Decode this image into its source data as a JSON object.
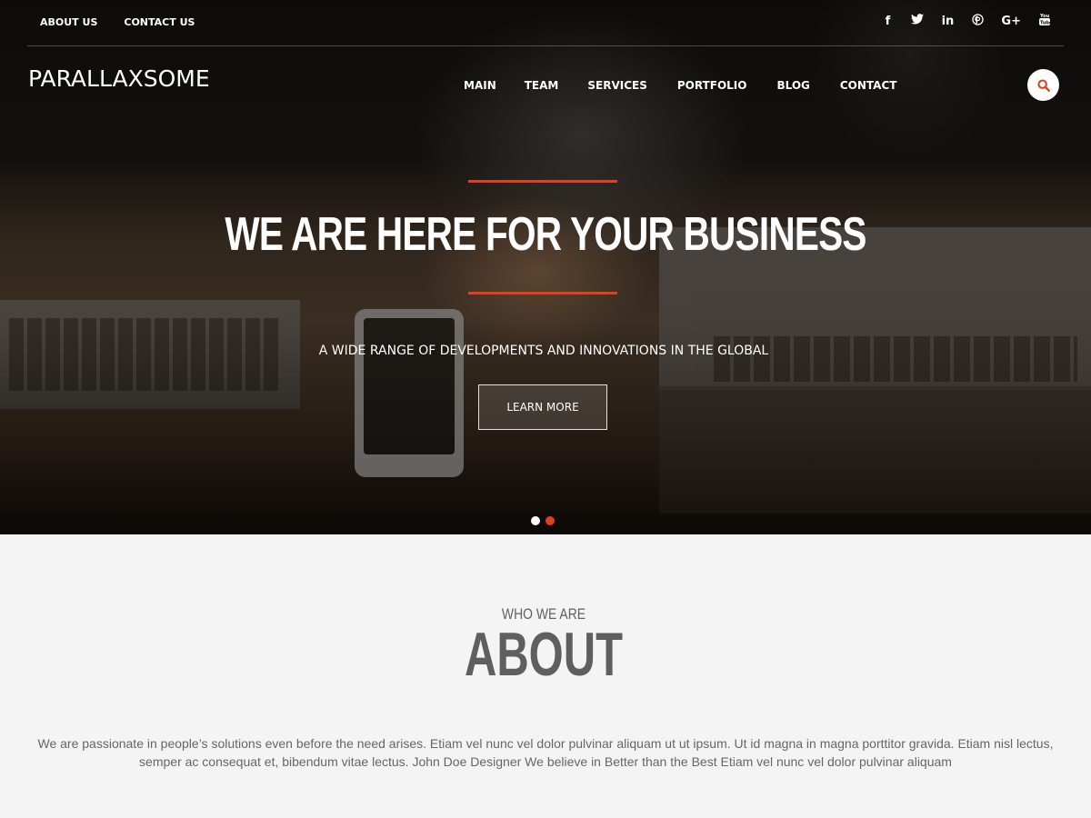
{
  "topbar": {
    "links": [
      "ABOUT US",
      "CONTACT US"
    ],
    "social": [
      {
        "name": "facebook-icon",
        "glyph": "f"
      },
      {
        "name": "twitter-icon",
        "glyph": "🐦"
      },
      {
        "name": "linkedin-icon",
        "glyph": "in"
      },
      {
        "name": "pinterest-icon",
        "glyph": "℗"
      },
      {
        "name": "google-plus-icon",
        "glyph": "G+"
      },
      {
        "name": "youtube-icon",
        "glyph": "▣"
      }
    ]
  },
  "header": {
    "logo": "PARALLAXSOME",
    "nav": [
      "MAIN",
      "TEAM",
      "SERVICES",
      "PORTFOLIO",
      "BLOG",
      "CONTACT"
    ],
    "search_icon": "search-icon"
  },
  "hero": {
    "title": "WE ARE HERE FOR YOUR BUSINESS",
    "subtitle": "A WIDE RANGE OF DEVELOPMENTS AND INNOVATIONS IN THE GLOBAL",
    "button": "LEARN MORE",
    "slides": 2,
    "active_slide": 2
  },
  "about": {
    "kicker": "WHO WE ARE",
    "heading": "ABOUT",
    "body": "We are passionate in people’s solutions even before the need arises. Etiam vel nunc vel dolor pulvinar aliquam ut ut ipsum. Ut id magna in magna porttitor gravida. Etiam nisl lectus, semper ac consequat et, bibendum vitae lectus. John Doe Designer We believe in Better than the Best Etiam vel nunc vel dolor pulvinar aliquam"
  },
  "colors": {
    "accent": "#e0401d",
    "about_bg": "#f4f4f4",
    "text_dark": "#5f5f5f"
  }
}
